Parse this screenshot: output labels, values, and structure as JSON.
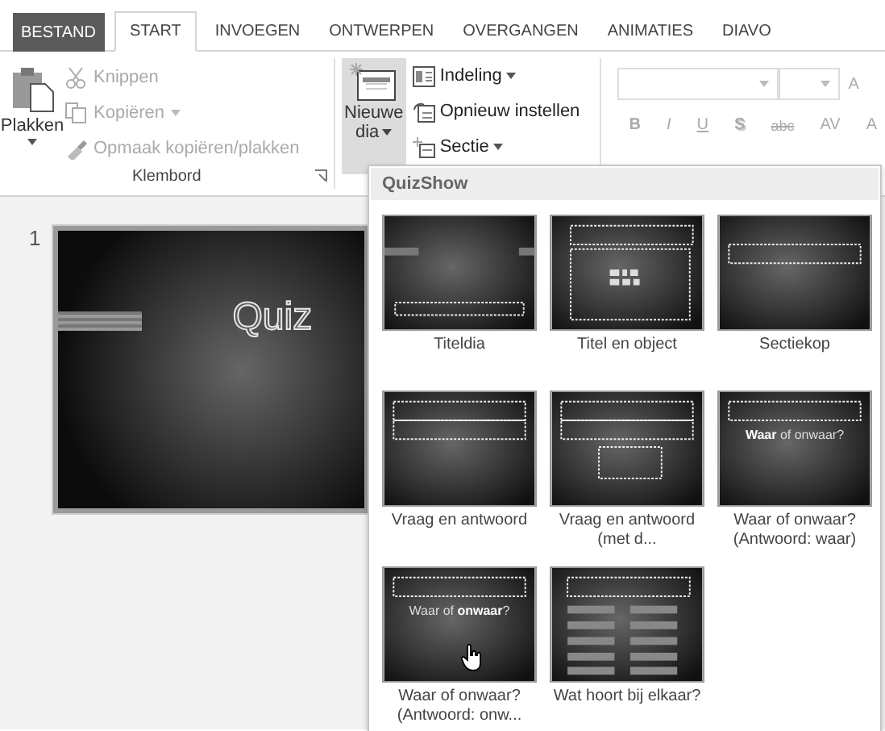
{
  "tabs": [
    {
      "label": "BESTAND",
      "kind": "file",
      "selected": false
    },
    {
      "label": "START",
      "kind": "tab",
      "selected": true
    },
    {
      "label": "INVOEGEN",
      "kind": "tab",
      "selected": false
    },
    {
      "label": "ONTWERPEN",
      "kind": "tab",
      "selected": false
    },
    {
      "label": "OVERGANGEN",
      "kind": "tab",
      "selected": false
    },
    {
      "label": "ANIMATIES",
      "kind": "tab",
      "selected": false
    },
    {
      "label": "DIAVO",
      "kind": "tab",
      "selected": false
    }
  ],
  "clipboard": {
    "paste": "Plakken",
    "items": [
      {
        "label": "Knippen",
        "disabled": true,
        "has_menu": false
      },
      {
        "label": "Kopiëren",
        "disabled": true,
        "has_menu": true
      },
      {
        "label": "Opmaak kopiëren/plakken",
        "disabled": true,
        "has_menu": false
      }
    ],
    "group_label": "Klembord"
  },
  "slides_group": {
    "new_slide": {
      "line_1": "Nieuwe",
      "line_2": "dia",
      "expanded": true
    },
    "items": [
      {
        "label": "Indeling",
        "has_menu": true
      },
      {
        "label": "Opnieuw instellen",
        "has_menu": false
      },
      {
        "label": "Sectie",
        "has_menu": true
      }
    ]
  },
  "font_group": {
    "buttons": [
      {
        "label": "B",
        "kind": "bold"
      },
      {
        "label": "I",
        "kind": "italic"
      },
      {
        "label": "U",
        "kind": "underline"
      },
      {
        "label": "S",
        "kind": "shadow"
      },
      {
        "label": "abc",
        "kind": "strike"
      },
      {
        "label": "AV",
        "kind": "spacing"
      },
      {
        "label": "A",
        "kind": "plain"
      }
    ],
    "grow": "A",
    "disabled": true
  },
  "slides": [
    {
      "number": "1",
      "title": "Quiz",
      "selected": true
    }
  ],
  "gallery": {
    "title": "QuizShow",
    "layouts": [
      {
        "label": "Titeldia",
        "kind": "title",
        "hovered": false
      },
      {
        "label": "Titel en object",
        "kind": "content",
        "hovered": false
      },
      {
        "label": "Sectiekop",
        "kind": "section",
        "hovered": false
      },
      {
        "label": "Vraag en antwoord",
        "kind": "qa",
        "hovered": false
      },
      {
        "label": "Vraag en antwoord (met d...",
        "kind": "qa-box",
        "hovered": false
      },
      {
        "label": "Waar of onwaar? (Antwoord: waar)",
        "kind": "truefalse",
        "text": "**Waar** of onwaar?",
        "hovered": false
      },
      {
        "label": "Waar of onwaar? (Antwoord: onw...",
        "kind": "truefalse",
        "text": "Waar of **onwaar**?",
        "hovered": true
      },
      {
        "label": "Wat hoort bij elkaar?",
        "kind": "match",
        "hovered": false
      }
    ]
  }
}
